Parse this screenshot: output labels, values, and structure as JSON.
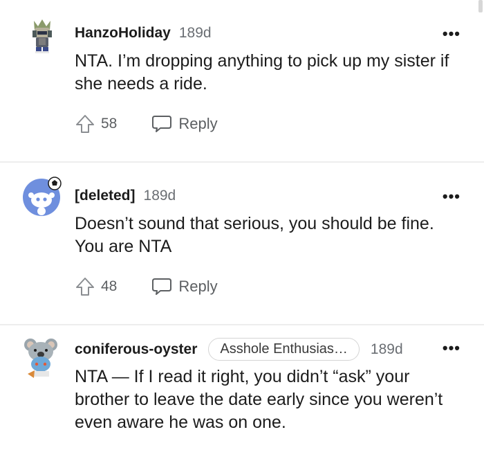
{
  "comments": [
    {
      "username": "HanzoHoliday",
      "age": "189d",
      "body": "NTA. I’m dropping anything to pick up my sister if she needs a ride.",
      "upvotes": "58",
      "reply_label": "Reply",
      "avatar_icon": "snoo-armor-avatar-icon"
    },
    {
      "username": "[deleted]",
      "age": "189d",
      "body": "Doesn’t sound that serious, you should be fine. You are NTA",
      "upvotes": "48",
      "reply_label": "Reply",
      "avatar_icon": "default-snoo-avatar-icon"
    },
    {
      "username": "coniferous-oyster",
      "flair": "Asshole Enthusias…",
      "age": "189d",
      "body": "NTA — If I read it right, you didn’t “ask” your brother to leave the date early since you weren’t even aware he was on one.",
      "avatar_icon": "koala-snoo-avatar-icon"
    }
  ],
  "more_label": "•••",
  "colors": {
    "text": "#1c1c1c",
    "muted": "#6a6e73",
    "avatar_blue": "#6f8fde",
    "divider": "#ededed"
  }
}
